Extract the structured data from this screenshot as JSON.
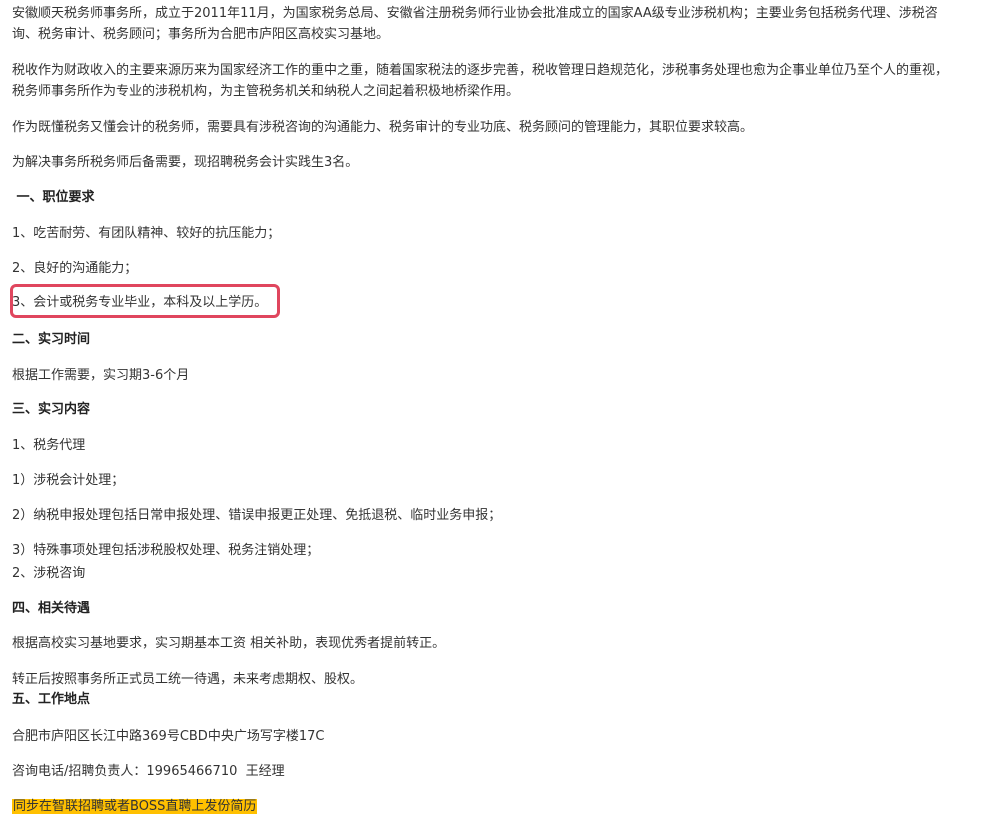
{
  "intro": {
    "p1_line1": "安徽顺天税务师事务所，成立于2011年11月，为国家税务总局、安徽省注册税务师行业协会批准成立的国家AA级专业涉税机构；主要业务包括税务代理、涉税咨",
    "p1_line2": "询、税务审计、税务顾问；事务所为合肥市庐阳区高校实习基地。",
    "p2_line1": "税收作为财政收入的主要来源历来为国家经济工作的重中之重，随着国家税法的逐步完善，税收管理日趋规范化，涉税事务处理也愈为企事业单位乃至个人的重视，",
    "p2_line2": "税务师事务所作为专业的涉税机构，为主管税务机关和纳税人之间起着积极地桥梁作用。",
    "p3": "作为既懂税务又懂会计的税务师，需要具有涉税咨询的沟通能力、税务审计的专业功底、税务顾问的管理能力，其职位要求较高。",
    "p4": "为解决事务所税务师后备需要，现招聘税务会计实践生3名。"
  },
  "requirements": {
    "heading": " 一、职位要求",
    "items": [
      "1、吃苦耐劳、有团队精神、较好的抗压能力；",
      "2、良好的沟通能力；",
      "3、会计或税务专业毕业，本科及以上学历。"
    ]
  },
  "period": {
    "heading": "二、实习时间",
    "text": "根据工作需要，实习期3-6个月"
  },
  "content": {
    "heading": "三、实习内容",
    "items": [
      "1、税务代理",
      "1）涉税会计处理；",
      "2）纳税申报处理包括日常申报处理、错误申报更正处理、免抵退税、临时业务申报；",
      "3）特殊事项处理包括涉税股权处理、税务注销处理；",
      "2、涉税咨询"
    ]
  },
  "benefits": {
    "heading": "四、相关待遇",
    "items": [
      "根据高校实习基地要求，实习期基本工资 相关补助，表现优秀者提前转正。",
      "转正后按照事务所正式员工统一待遇，未来考虑期权、股权。"
    ]
  },
  "location": {
    "heading": "五、工作地点",
    "address": "合肥市庐阳区长江中路369号CBD中央广场写字楼17C",
    "contact": "咨询电话/招聘负责人：19965466710  王经理",
    "apply_note": "同步在智联招聘或者BOSS直聘上发份简历"
  },
  "colors": {
    "highlight_border": "#e0465e",
    "highlight_fill": "#ffc000",
    "text": "#333333"
  }
}
